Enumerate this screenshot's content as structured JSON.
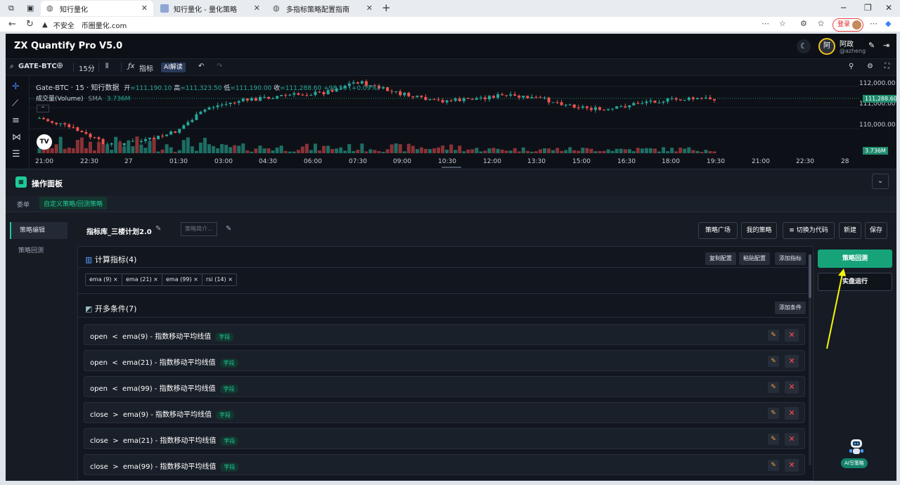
{
  "browser": {
    "tabs": [
      {
        "title": "知行量化",
        "active": true
      },
      {
        "title": "知行量化 - 量化策略",
        "active": false
      },
      {
        "title": "多指标策略配置指南",
        "active": false
      }
    ],
    "address": {
      "security": "不安全",
      "url": "币圈量化.com"
    },
    "login": "登录"
  },
  "app": {
    "title": "ZX Quantify Pro V5.0",
    "user": {
      "avatar_char": "阿",
      "name": "阿政",
      "handle": "@azheng"
    }
  },
  "toolbar": {
    "symbol": "GATE-BTC",
    "interval": "15分",
    "indicator": "指标",
    "ai": "AI解读"
  },
  "chart_header": {
    "title": "Gate-BTC · 15 · 知行数据",
    "open_label": "开",
    "open": "=111,190.10",
    "high_label": "高",
    "high": "=111,323.50",
    "low_label": "低",
    "low": "=111,190.00",
    "close_label": "收",
    "close": "=111,288.60",
    "change": "+98.50 (+0.09%)",
    "volume_label": "成交量(Volume)",
    "sma": "SMA",
    "volume_value": "3.736M"
  },
  "chart_data": {
    "type": "candlestick",
    "y_ticks": [
      "112,000.00",
      "111,000.00",
      "110,000.00"
    ],
    "last_price": "111,288.60",
    "volume_last": "3.736M",
    "x_ticks": [
      "21:00",
      "22:30",
      "27",
      "01:30",
      "03:00",
      "04:30",
      "06:00",
      "07:30",
      "09:00",
      "10:30",
      "12:00",
      "13:30",
      "15:00",
      "16:30",
      "18:00",
      "19:30",
      "21:00",
      "22:30",
      "28"
    ]
  },
  "panel": {
    "title": "操作面板",
    "tabs": [
      "委单",
      "自定义策略/回测策略"
    ],
    "side": [
      "策略编辑",
      "策略回测"
    ],
    "strategy_name": "指标库_三楼计划2.0",
    "brief_placeholder": "策略简介...",
    "top_buttons": [
      "策略广场",
      "我的策略",
      "切换为代码",
      "新建",
      "保存"
    ],
    "indicators": {
      "title": "计算指标(4)",
      "buttons": [
        "复制配置",
        "粘贴配置",
        "添加指标"
      ],
      "chips": [
        "ema (9)",
        "ema (21)",
        "ema (99)",
        "rsi (14)"
      ]
    },
    "long_conditions": {
      "title": "开多条件(7)",
      "add": "添加条件",
      "rows": [
        {
          "text": "open  <  ema(9) - 指数移动平均线值",
          "badge": "字段"
        },
        {
          "text": "open  <  ema(21) - 指数移动平均线值",
          "badge": "字段"
        },
        {
          "text": "open  <  ema(99) - 指数移动平均线值",
          "badge": "字段"
        },
        {
          "text": "close  >  ema(9) - 指数移动平均线值",
          "badge": "字段"
        },
        {
          "text": "close  >  ema(21) - 指数移动平均线值",
          "badge": "字段"
        },
        {
          "text": "close  >  ema(99) - 指数移动平均线值",
          "badge": "字段"
        }
      ]
    },
    "run_backtest": "策略回测",
    "run_live": "实盘运行",
    "ai_write": "AI写策略"
  }
}
